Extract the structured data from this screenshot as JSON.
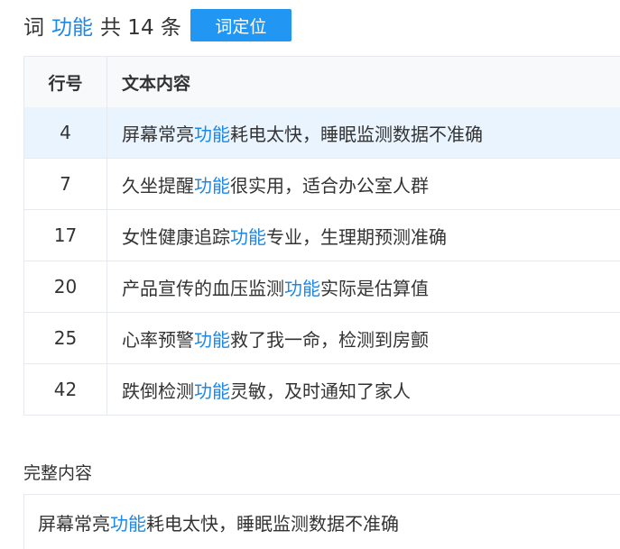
{
  "header": {
    "prefix": "词",
    "keyword": "功能",
    "count_text": "共 14 条",
    "locate_button": "词定位"
  },
  "table": {
    "columns": [
      "行号",
      "文本内容"
    ],
    "rows": [
      {
        "line": "4",
        "before": "屏幕常亮",
        "highlight": "功能",
        "after": "耗电太快，睡眠监测数据不准确",
        "selected": true
      },
      {
        "line": "7",
        "before": "久坐提醒",
        "highlight": "功能",
        "after": "很实用，适合办公室人群",
        "selected": false
      },
      {
        "line": "17",
        "before": "女性健康追踪",
        "highlight": "功能",
        "after": "专业，生理期预测准确",
        "selected": false
      },
      {
        "line": "20",
        "before": "产品宣传的血压监测",
        "highlight": "功能",
        "after": "实际是估算值",
        "selected": false
      },
      {
        "line": "25",
        "before": "心率预警",
        "highlight": "功能",
        "after": "救了我一命，检测到房颤",
        "selected": false
      },
      {
        "line": "42",
        "before": "跌倒检测",
        "highlight": "功能",
        "after": "灵敏，及时通知了家人",
        "selected": false
      }
    ]
  },
  "full_content": {
    "title": "完整内容",
    "before": "屏幕常亮",
    "highlight": "功能",
    "after": "耗电太快，睡眠监测数据不准确"
  },
  "colors": {
    "accent": "#1e88e5",
    "button": "#2196f3",
    "selected_row": "#e9f4fe"
  }
}
